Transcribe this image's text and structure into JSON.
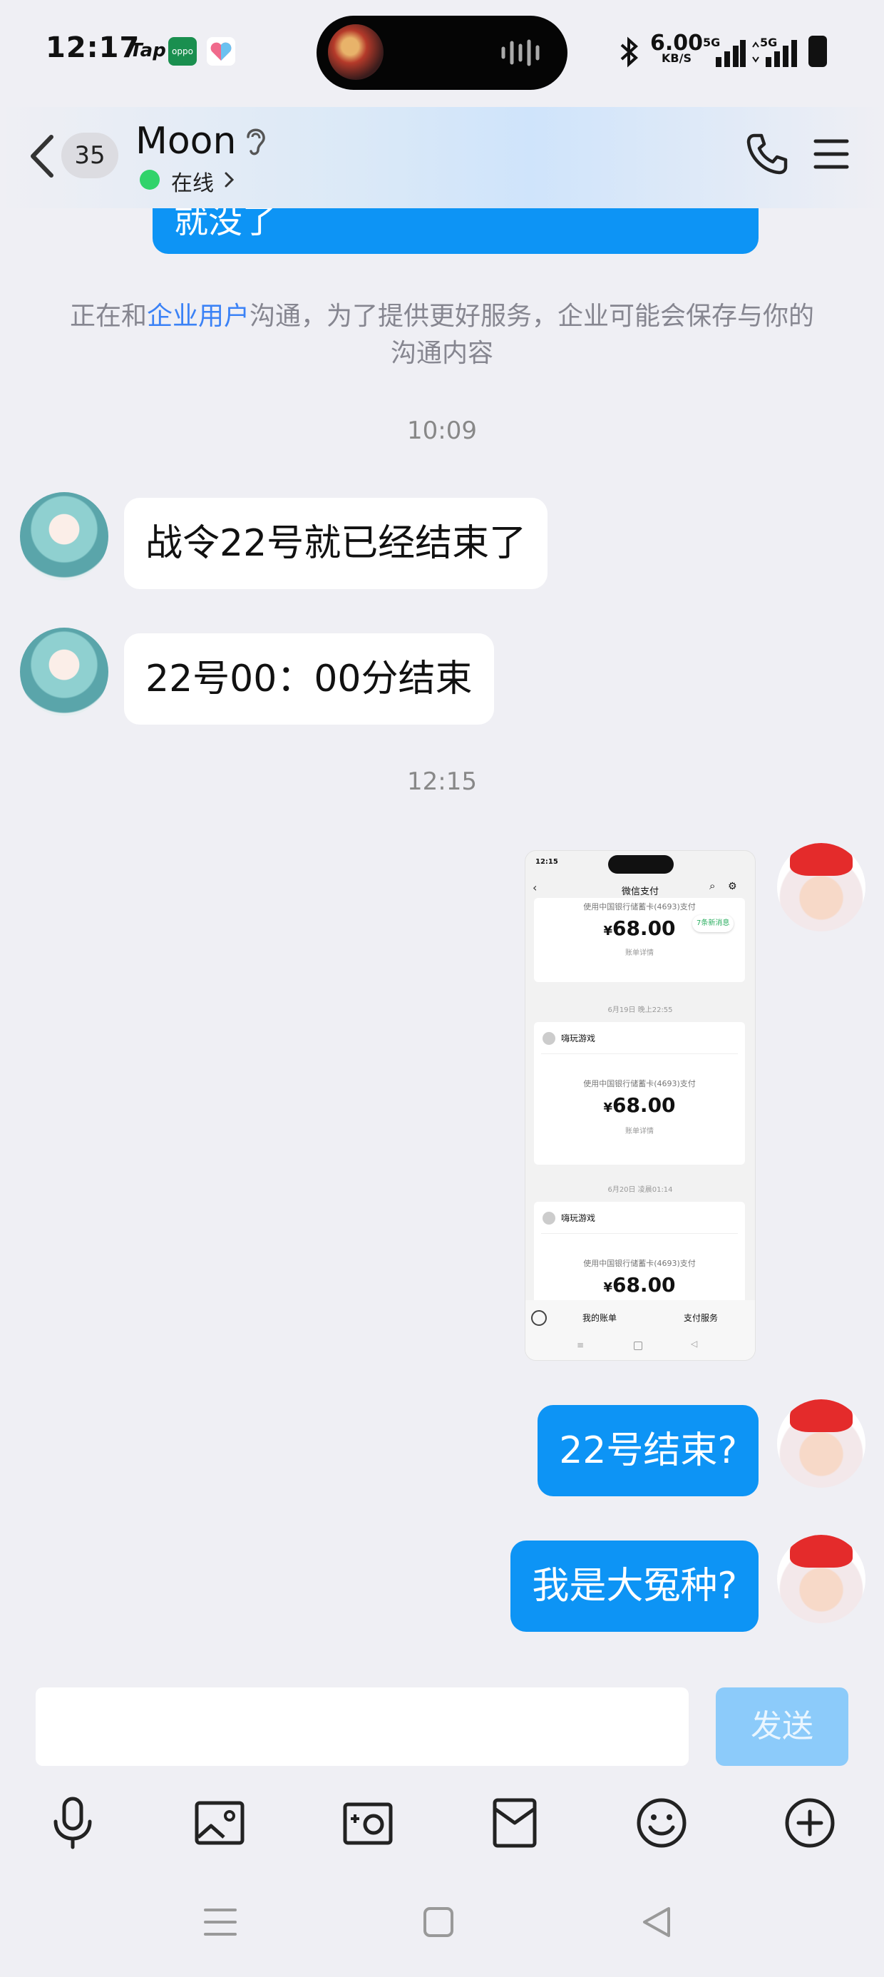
{
  "status_bar": {
    "time": "12:17",
    "app_tap": "Tap",
    "app_oppo": "oppo",
    "net_speed_value": "6.00",
    "net_speed_unit": "KB/S",
    "sim1": "5G",
    "sim2": "5G"
  },
  "header": {
    "unread_count": "35",
    "contact_name": "Moon",
    "presence": "在线"
  },
  "chat": {
    "prev_message_partial": "就没了",
    "notice_prefix": "正在和",
    "notice_highlight": "企业用户",
    "notice_suffix": "沟通，为了提供更好服务，企业可能会保存与你的沟通内容",
    "timestamp_1": "10:09",
    "msg_1": "战令22号就已经结束了",
    "msg_2": "22号00：00分结束",
    "timestamp_2": "12:15",
    "msg_3": "22号结束?",
    "msg_4": "我是大冤种?"
  },
  "screenshot_message": {
    "time": "12:15",
    "title": "微信支付",
    "new_msgs": "7条新消息",
    "card1_pay_line": "使用中国银行储蓄卡(4693)支付",
    "card1_amount": "68.00",
    "card1_detail": "账单详情",
    "date_2": "6月19日 晚上22:55",
    "merchant_2": "嗨玩游戏",
    "card2_pay_line": "使用中国银行储蓄卡(4693)支付",
    "card2_amount": "68.00",
    "card2_detail": "账单详情",
    "date_3": "6月20日 凌晨01:14",
    "merchant_3": "嗨玩游戏",
    "card3_pay_line": "使用中国银行储蓄卡(4693)支付",
    "card3_amount": "68.00",
    "tab_bills": "我的账单",
    "tab_services": "支付服务",
    "currency": "¥"
  },
  "input": {
    "send_label": "发送"
  },
  "icons": [
    "back-icon",
    "ear-icon",
    "phone-icon",
    "menu-icon",
    "mic-icon",
    "image-icon",
    "camera-icon",
    "red-packet-icon",
    "emoji-icon",
    "plus-icon",
    "nav-menu-icon",
    "nav-home-icon",
    "nav-back-icon"
  ]
}
